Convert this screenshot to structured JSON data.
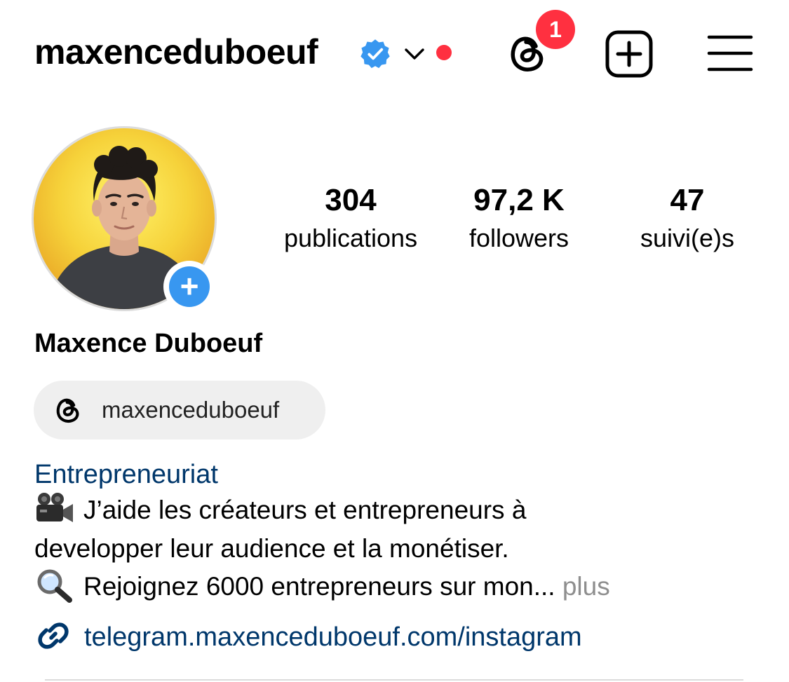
{
  "header": {
    "username": "maxenceduboeuf",
    "threads_badge_count": "1",
    "icons": {
      "verified": "verified-badge-icon",
      "switch_account": "chevron-down-icon",
      "threads": "threads-icon",
      "create": "plus-square-icon",
      "menu": "hamburger-menu-icon"
    }
  },
  "profile": {
    "avatar": "profile-photo",
    "add_story_icon": "plus-icon",
    "display_name": "Maxence Duboeuf",
    "stats": [
      {
        "value": "304",
        "label": "publications"
      },
      {
        "value": "97,2 K",
        "label": "followers"
      },
      {
        "value": "47",
        "label": "suivi(e)s"
      }
    ],
    "threads_chip": {
      "label": "maxenceduboeuf",
      "icon": "threads-icon"
    },
    "category": "Entrepreneuriat",
    "bio": {
      "line1": "J’aide les créateurs et entrepreneurs à",
      "line1_emoji": "movie-camera-icon",
      "line2": "developper leur audience et la monétiser.",
      "line3": "Rejoignez 6000 entrepreneurs sur mon...",
      "line3_emoji": "magnifying-glass-icon",
      "more": "plus"
    },
    "link": {
      "text": "telegram.maxenceduboeuf.com/instagram",
      "icon": "link-icon"
    }
  },
  "colors": {
    "verified_blue": "#3897f0",
    "notification_red": "#ff3040",
    "link_blue": "#00376b",
    "add_story_blue": "#3897f0",
    "muted_gray": "#8e8e8e"
  }
}
